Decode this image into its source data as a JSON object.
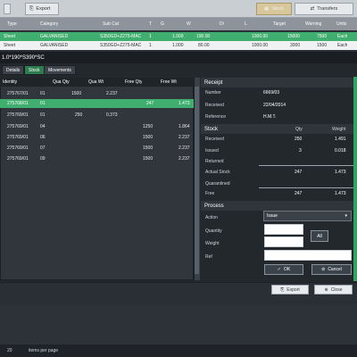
{
  "toolbar": {
    "export_label": "Export",
    "stock_label": "Stock",
    "transfers_label": "Transfers"
  },
  "grid": {
    "headers": [
      "Type",
      "Category",
      "Sub Cat",
      "T",
      "G",
      "W",
      "Di",
      "L",
      "Target",
      "Warning",
      "Units"
    ],
    "rows": [
      [
        "Sheet",
        "GALVANISED",
        "S350GD+Z275-MAC",
        "1",
        "1.000",
        "190.00",
        "",
        "1000.00",
        "15000",
        "7500",
        "Each"
      ],
      [
        "Sheet",
        "GALVANISED",
        "S350GD+Z275-MAC",
        "1",
        "1.000",
        "80.00",
        "",
        "1000.00",
        "3000",
        "1500",
        "Each"
      ]
    ]
  },
  "dialog": {
    "title": "1.0*190*S390*SC",
    "tabs": [
      "Details",
      "Stock",
      "Movements"
    ],
    "table": {
      "headers": [
        "Identity",
        "",
        "Qua Qty",
        "Qua Wt",
        "Free Qty",
        "Free Wt"
      ],
      "rows": [
        [
          "275767/01",
          "01",
          "1500",
          "2.237",
          "",
          ""
        ],
        [
          "275768/01",
          "01",
          "",
          "",
          "247",
          "1.473"
        ],
        [
          "275769/01",
          "01",
          "250",
          "0.373",
          "",
          ""
        ],
        [
          "275769/01",
          "04",
          "",
          "",
          "1250",
          "1.864"
        ],
        [
          "275769/01",
          "06",
          "",
          "",
          "1500",
          "2.237"
        ],
        [
          "275769/01",
          "07",
          "",
          "",
          "1500",
          "2.237"
        ],
        [
          "275769/01",
          "09",
          "",
          "",
          "1500",
          "2.237"
        ]
      ]
    },
    "receipt": {
      "heading": "Receipt",
      "number_label": "Number",
      "number": "6669/03",
      "received_label": "Received",
      "received": "22/04/2014",
      "reference_label": "Reference",
      "reference": "H.M.T."
    },
    "stock": {
      "heading": "Stock",
      "qty_header": "Qty",
      "weight_header": "Weight",
      "rows": [
        {
          "label": "Received",
          "qty": "250",
          "weight": "1.491"
        },
        {
          "label": "Issued",
          "qty": "3",
          "weight": "0.018"
        },
        {
          "label": "Returned",
          "qty": "",
          "weight": ""
        },
        {
          "label": "Actual Stock",
          "qty": "247",
          "weight": "1.473"
        },
        {
          "label": "Quarantined",
          "qty": "",
          "weight": ""
        },
        {
          "label": "Free",
          "qty": "247",
          "weight": "1.473"
        }
      ]
    },
    "process": {
      "heading": "Process",
      "action_label": "Action",
      "action_value": "Issue",
      "quantity_label": "Quantity",
      "weight_label": "Weight",
      "ref_label": "Ref",
      "all_label": "All",
      "ok_label": "OK",
      "cancel_label": "Cancel"
    },
    "footer": {
      "export_label": "Export",
      "close_label": "Close"
    }
  },
  "pager": {
    "page_size": "20",
    "label": "items per page"
  }
}
